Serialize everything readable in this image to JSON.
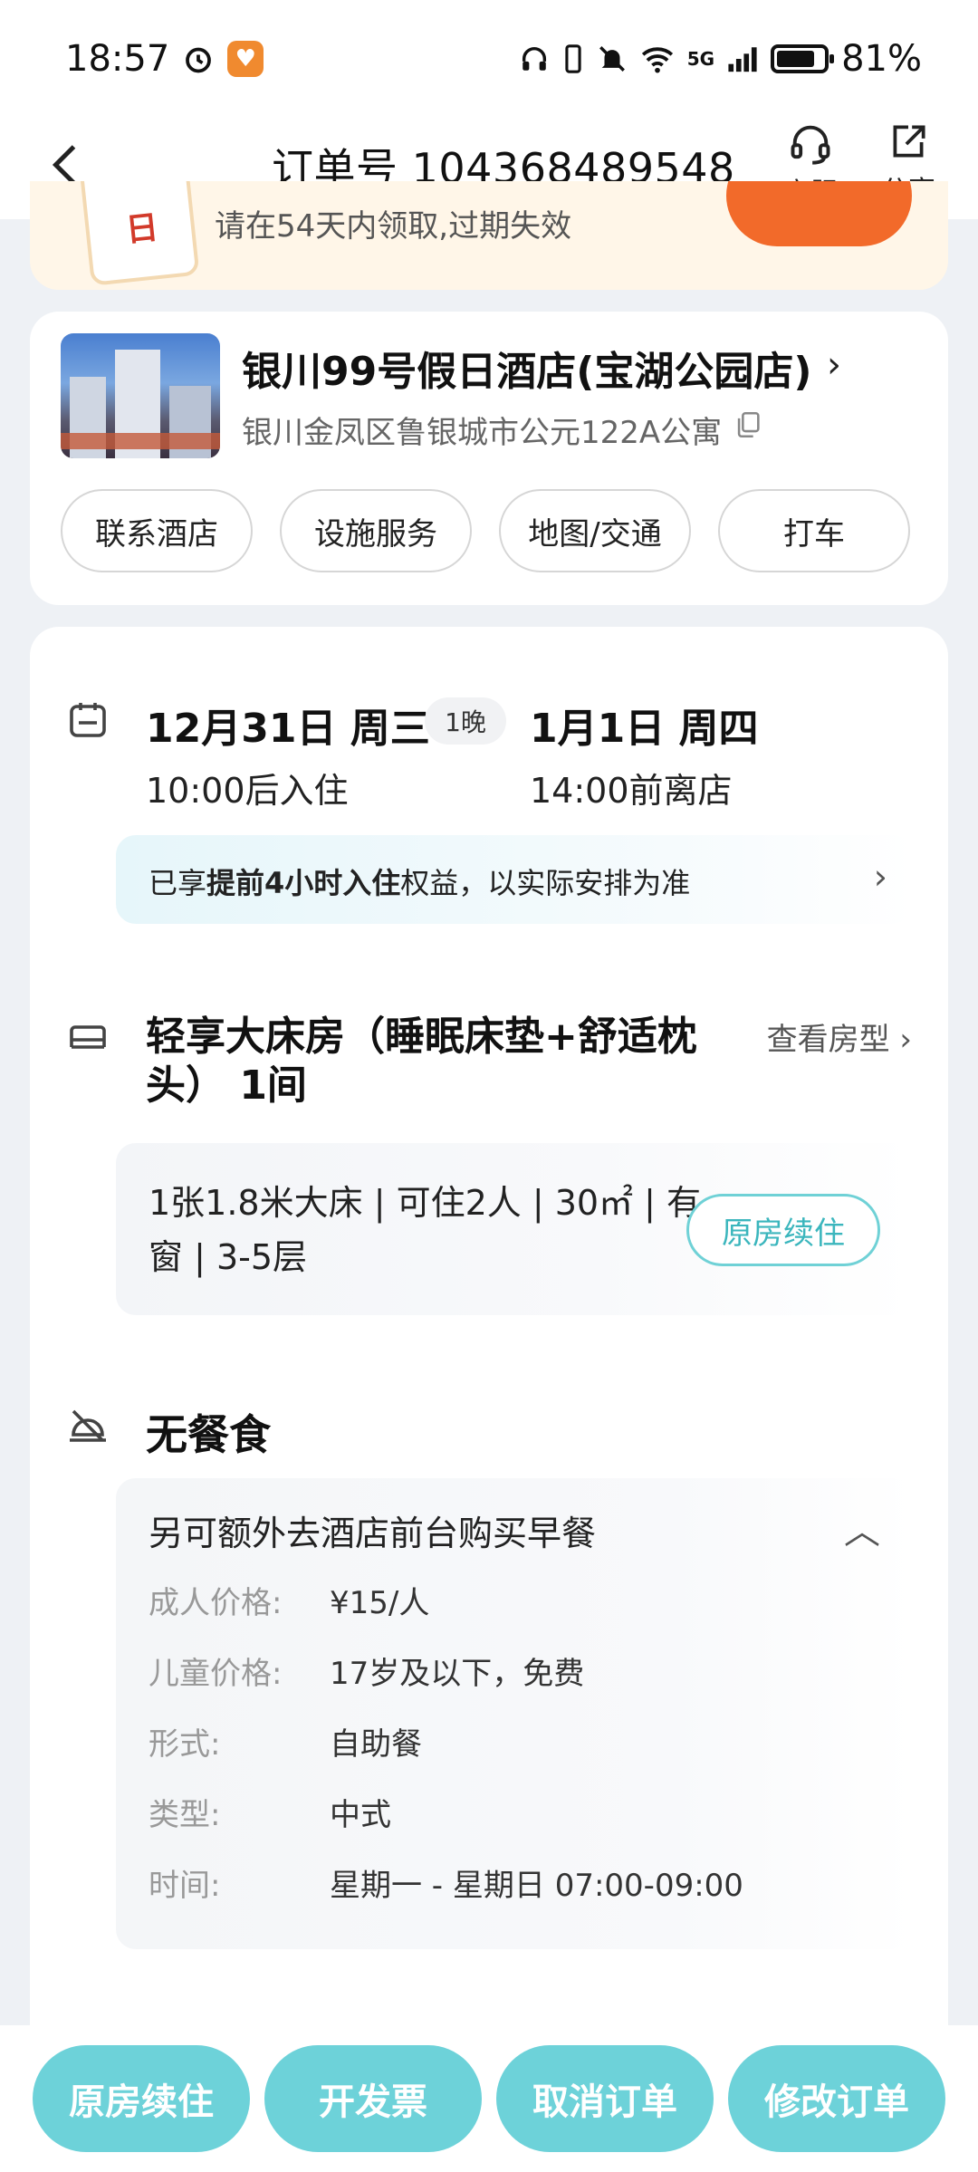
{
  "status_bar": {
    "time": "18:57",
    "network": "5G",
    "battery": "81%",
    "battery_level": 0.81
  },
  "nav": {
    "title": "订单号 104368489548",
    "service_label": "客服",
    "share_label": "分享"
  },
  "promo": {
    "ticket_glyph": "日",
    "text": "请在54天内领取,过期失效"
  },
  "hotel": {
    "name": "银川99号假日酒店(宝湖公园店)",
    "address": "银川金凤区鲁银城市公元122A公寓",
    "actions": [
      "联系酒店",
      "设施服务",
      "地图/交通",
      "打车"
    ]
  },
  "stay": {
    "checkin_date": "12月31日 周三",
    "nights": "1晚",
    "checkout_date": "1月1日 周四",
    "checkin_time": "10:00后入住",
    "checkout_time": "14:00前离店",
    "perk_prefix": "已享",
    "perk_bold": "提前4小时入住",
    "perk_suffix": "权益，以实际安排为准"
  },
  "room": {
    "title": "轻享大床房（睡眠床垫+舒适枕头） 1间",
    "view_link": "查看房型",
    "specs": "1张1.8米大床 | 可住2人 | 30㎡ | 有窗 | 3-5层",
    "renew_label": "原房续住"
  },
  "meal": {
    "title": "无餐食",
    "extra_note": "另可额外去酒店前台购买早餐",
    "rows": [
      {
        "k": "成人价格:",
        "v": "¥15/人"
      },
      {
        "k": "儿童价格:",
        "v": "17岁及以下，免费"
      },
      {
        "k": "形式:",
        "v": "自助餐"
      },
      {
        "k": "类型:",
        "v": "中式"
      },
      {
        "k": "时间:",
        "v": "星期一 - 星期日 07:00-09:00"
      }
    ]
  },
  "bottom_actions": [
    "原房续住",
    "开发票",
    "取消订单",
    "修改订单"
  ],
  "colors": {
    "accent": "#6dd2d9",
    "accent_text": "#3bb6bd",
    "promo_orange": "#f26a2a"
  }
}
